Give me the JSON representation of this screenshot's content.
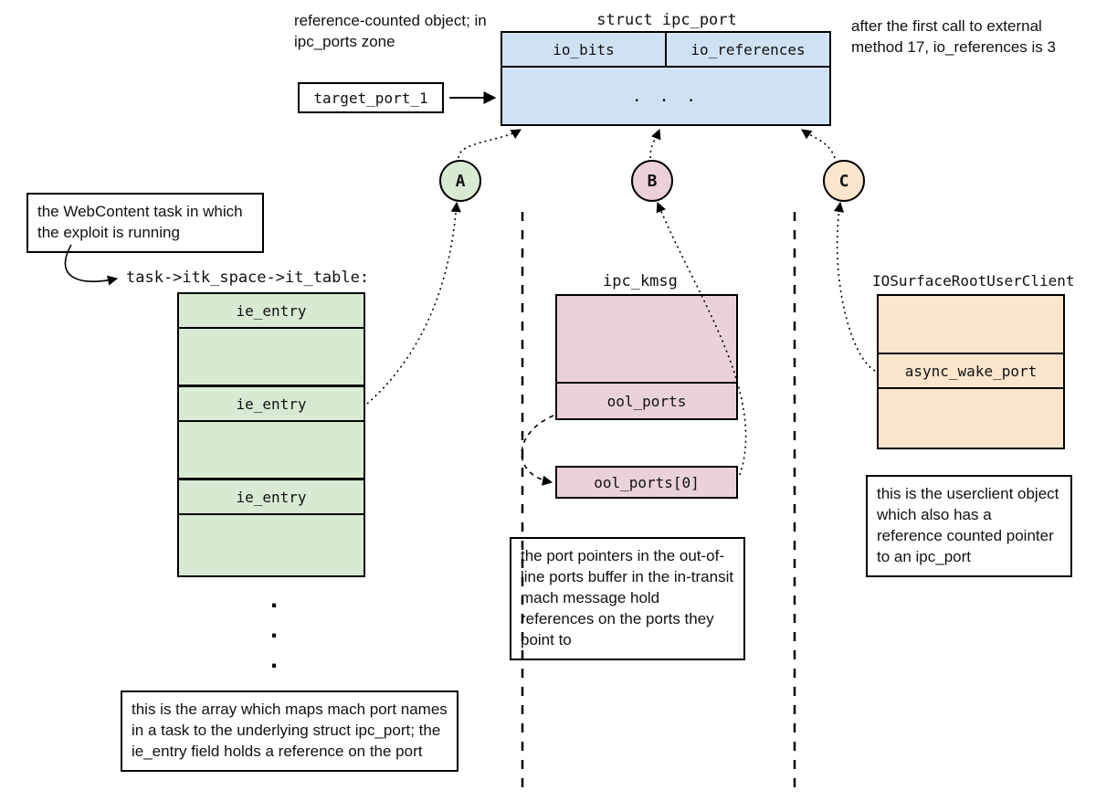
{
  "top_note_left": "reference-counted object; in ipc_ports zone",
  "top_note_right": "after the first call to external method 17, io_references is 3",
  "ipc_port": {
    "title": "struct ipc_port",
    "col1": "io_bits",
    "col2": "io_references",
    "ellipsis": ". . ."
  },
  "target_port_label": "target_port_1",
  "circles": {
    "a": "A",
    "b": "B",
    "c": "C"
  },
  "webcontent_note": "the WebContent task in which the exploit is running",
  "task_path": "task->itk_space->it_table:",
  "it_table": {
    "entry_label": "ie_entry"
  },
  "it_table_note": "this is the array which maps mach port names in a task to the underlying struct ipc_port; the ie_entry field holds a reference on the port",
  "ipc_kmsg": {
    "title": "ipc_kmsg",
    "field": "ool_ports",
    "array_item": "ool_ports[0]"
  },
  "ipc_kmsg_note": "the port pointers in the out-of-line ports buffer in the in-transit mach message hold references on the ports they point to",
  "iosurface": {
    "title": "IOSurfaceRootUserClient",
    "field": "async_wake_port"
  },
  "iosurface_note": "this is the userclient object which also has a reference counted pointer to an ipc_port"
}
